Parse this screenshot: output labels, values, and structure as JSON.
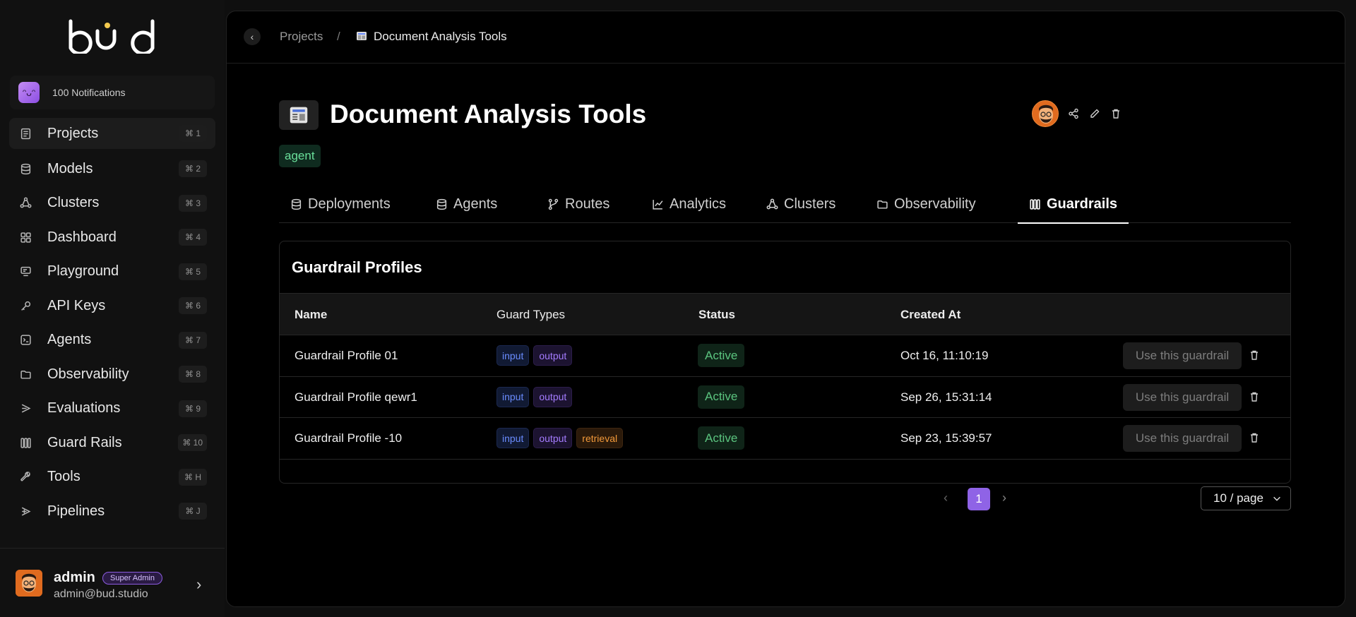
{
  "sidebar": {
    "logo_text": "bud",
    "notifications": "100 Notifications",
    "items": [
      {
        "label": "Projects",
        "kbd": "⌘ 1",
        "icon": "document-icon"
      },
      {
        "label": "Models",
        "kbd": "⌘ 2",
        "icon": "database-icon"
      },
      {
        "label": "Clusters",
        "kbd": "⌘ 3",
        "icon": "cluster-icon"
      },
      {
        "label": "Dashboard",
        "kbd": "⌘ 4",
        "icon": "grid-icon"
      },
      {
        "label": "Playground",
        "kbd": "⌘ 5",
        "icon": "playground-icon"
      },
      {
        "label": "API Keys",
        "kbd": "⌘ 6",
        "icon": "key-icon"
      },
      {
        "label": "Agents",
        "kbd": "⌘ 7",
        "icon": "terminal-icon"
      },
      {
        "label": "Observability",
        "kbd": "⌘ 8",
        "icon": "folder-icon"
      },
      {
        "label": "Evaluations",
        "kbd": "⌘ 9",
        "icon": "evaluation-icon"
      },
      {
        "label": "Guard Rails",
        "kbd": "⌘ 10",
        "icon": "guardrail-icon"
      },
      {
        "label": "Tools",
        "kbd": "⌘ H",
        "icon": "wrench-icon"
      },
      {
        "label": "Pipelines",
        "kbd": "⌘ J",
        "icon": "pipeline-icon"
      }
    ],
    "user": {
      "name": "admin",
      "badge": "Super Admin",
      "email": "admin@bud.studio"
    }
  },
  "breadcrumb": {
    "parent": "Projects",
    "separator": "/",
    "current": "Document Analysis Tools"
  },
  "project": {
    "title": "Document Analysis Tools",
    "tag": "agent"
  },
  "tabs": [
    {
      "label": "Deployments"
    },
    {
      "label": "Agents"
    },
    {
      "label": "Routes"
    },
    {
      "label": "Analytics"
    },
    {
      "label": "Clusters"
    },
    {
      "label": "Observability"
    },
    {
      "label": "Guardrails"
    }
  ],
  "active_tab": "Guardrails",
  "guardrails": {
    "title": "Guardrail Profiles",
    "columns": [
      "Name",
      "Guard Types",
      "Status",
      "Created At"
    ],
    "rows": [
      {
        "name": "Guardrail Profile 01",
        "types": [
          "input",
          "output"
        ],
        "status": "Active",
        "created": "Oct 16, 11:10:19",
        "action": "Use this guardrail"
      },
      {
        "name": "Guardrail Profile qewr1",
        "types": [
          "input",
          "output"
        ],
        "status": "Active",
        "created": "Sep 26, 15:31:14",
        "action": "Use this guardrail"
      },
      {
        "name": "Guardrail Profile -10",
        "types": [
          "input",
          "output",
          "retrieval"
        ],
        "status": "Active",
        "created": "Sep 23, 15:39:57",
        "action": "Use this guardrail"
      }
    ]
  },
  "pagination": {
    "current_page": "1",
    "page_size": "10 / page"
  },
  "colors": {
    "accent": "#8f63e6",
    "active_status": "#5bc47f",
    "tag": "#6ae09b"
  }
}
